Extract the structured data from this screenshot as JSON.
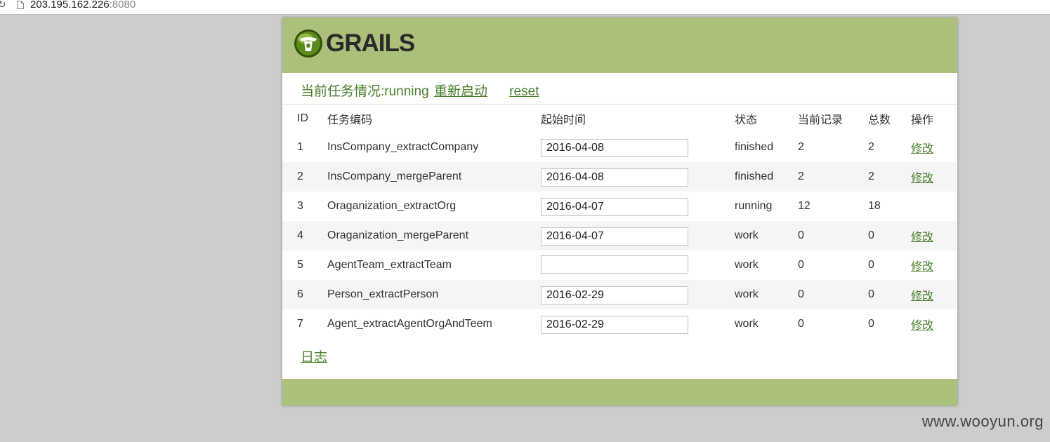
{
  "browser": {
    "url_host": "203.195.162.226",
    "url_port": ":8080"
  },
  "logo": {
    "text": "GRAILS"
  },
  "status": {
    "label": "当前任务情况:running",
    "restart_link": "重新启动",
    "reset_link": "reset"
  },
  "table": {
    "headers": {
      "id": "ID",
      "code": "任务编码",
      "start_time": "起始时间",
      "state": "状态",
      "current": "当前记录",
      "total": "总数",
      "action": "操作"
    },
    "rows": [
      {
        "id": "1",
        "code": "InsCompany_extractCompany",
        "start_time": "2016-04-08",
        "state": "finished",
        "current": "2",
        "total": "2",
        "action": "修改"
      },
      {
        "id": "2",
        "code": "InsCompany_mergeParent",
        "start_time": "2016-04-08",
        "state": "finished",
        "current": "2",
        "total": "2",
        "action": "修改"
      },
      {
        "id": "3",
        "code": "Oraganization_extractOrg",
        "start_time": "2016-04-07",
        "state": "running",
        "current": "12",
        "total": "18",
        "action": ""
      },
      {
        "id": "4",
        "code": "Oraganization_mergeParent",
        "start_time": "2016-04-07",
        "state": "work",
        "current": "0",
        "total": "0",
        "action": "修改"
      },
      {
        "id": "5",
        "code": "AgentTeam_extractTeam",
        "start_time": "",
        "state": "work",
        "current": "0",
        "total": "0",
        "action": "修改"
      },
      {
        "id": "6",
        "code": "Person_extractPerson",
        "start_time": "2016-02-29",
        "state": "work",
        "current": "0",
        "total": "0",
        "action": "修改"
      },
      {
        "id": "7",
        "code": "Agent_extractAgentOrgAndTeem",
        "start_time": "2016-02-29",
        "state": "work",
        "current": "0",
        "total": "0",
        "action": "修改"
      }
    ]
  },
  "log_link": "日志",
  "watermark": "www.wooyun.org",
  "colors": {
    "header_green": "#abc07a",
    "link_green": "#48802c",
    "page_bg": "#cdcdcd"
  }
}
